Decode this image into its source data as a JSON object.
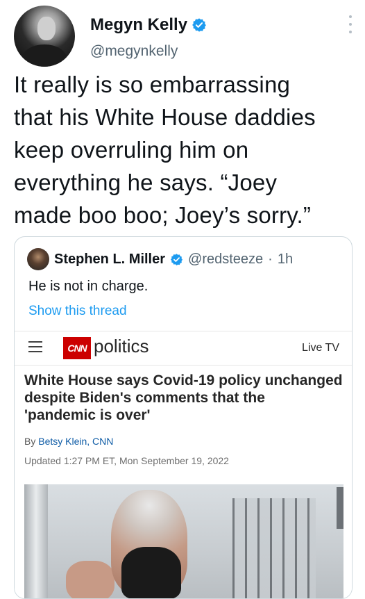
{
  "tweet": {
    "author_name": "Megyn Kelly",
    "author_handle": "@megynkelly",
    "text_lines": [
      "It really is so embarrassing",
      "that his White House daddies",
      "keep overruling him on",
      "everything he says. “Joey",
      "made boo boo; Joey’s sorry.”"
    ],
    "verified_color": "#1d9bf0"
  },
  "quote": {
    "author_name": "Stephen L. Miller",
    "author_handle": "@redsteeze",
    "separator": "·",
    "time": "1h",
    "text": "He is not in charge.",
    "show_thread": "Show this thread"
  },
  "article": {
    "logo_text": "CNN",
    "section": "politics",
    "live_tv": "Live TV",
    "headline_lines": [
      "White House says Covid-19 policy unchanged",
      "despite Biden's comments that the",
      "'pandemic is over'"
    ],
    "byline_prefix": "By",
    "byline_author": "Betsy Klein, CNN",
    "updated": "Updated 1:27 PM ET, Mon September 19, 2022",
    "brand_color": "#cc0000"
  }
}
